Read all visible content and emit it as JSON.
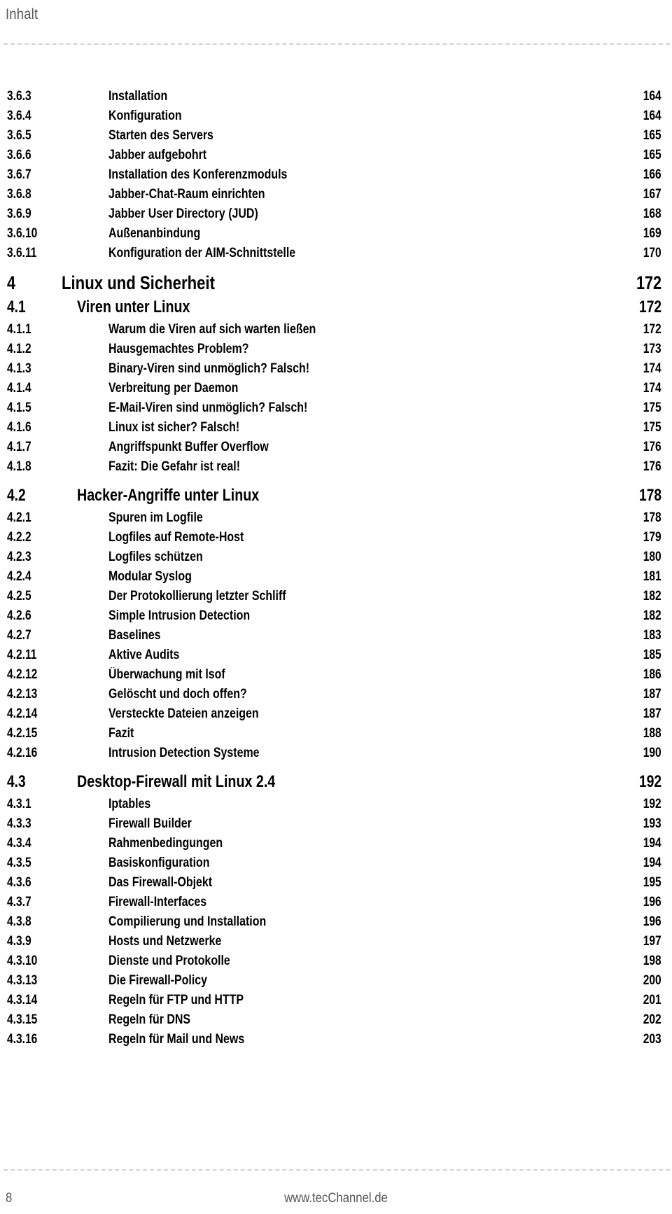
{
  "header": {
    "title": "Inhalt"
  },
  "footer": {
    "page_number": "8",
    "site": "www.tecChannel.de"
  },
  "colors": {
    "text": "#000000",
    "muted": "#55555a",
    "rule": "#d2d2d6",
    "background": "#ffffff"
  },
  "toc": {
    "entries": [
      {
        "level": "sub",
        "number": "3.6.3",
        "title": "Installation",
        "page": "164"
      },
      {
        "level": "sub",
        "number": "3.6.4",
        "title": "Konfiguration",
        "page": "164"
      },
      {
        "level": "sub",
        "number": "3.6.5",
        "title": "Starten des Servers",
        "page": "165"
      },
      {
        "level": "sub",
        "number": "3.6.6",
        "title": "Jabber aufgebohrt",
        "page": "165"
      },
      {
        "level": "sub",
        "number": "3.6.7",
        "title": "Installation des Konferenzmoduls",
        "page": "166"
      },
      {
        "level": "sub",
        "number": "3.6.8",
        "title": "Jabber-Chat-Raum einrichten",
        "page": "167"
      },
      {
        "level": "sub",
        "number": "3.6.9",
        "title": "Jabber User Directory (JUD)",
        "page": "168"
      },
      {
        "level": "sub",
        "number": "3.6.10",
        "title": "Außenanbindung",
        "page": "169"
      },
      {
        "level": "sub",
        "number": "3.6.11",
        "title": "Konfiguration der AIM-Schnittstelle",
        "page": "170"
      },
      {
        "level": "chap",
        "number": "4",
        "title": "Linux und Sicherheit",
        "page": "172"
      },
      {
        "level": "sec",
        "number": "4.1",
        "title": "Viren unter Linux",
        "page": "172"
      },
      {
        "level": "sub",
        "number": "4.1.1",
        "title": "Warum die Viren auf sich warten ließen",
        "page": "172"
      },
      {
        "level": "sub",
        "number": "4.1.2",
        "title": "Hausgemachtes Problem?",
        "page": "173"
      },
      {
        "level": "sub",
        "number": "4.1.3",
        "title": "Binary-Viren sind unmöglich? Falsch!",
        "page": "174"
      },
      {
        "level": "sub",
        "number": "4.1.4",
        "title": "Verbreitung per Daemon",
        "page": "174"
      },
      {
        "level": "sub",
        "number": "4.1.5",
        "title": "E-Mail-Viren sind unmöglich? Falsch!",
        "page": "175"
      },
      {
        "level": "sub",
        "number": "4.1.6",
        "title": "Linux ist sicher? Falsch!",
        "page": "175"
      },
      {
        "level": "sub",
        "number": "4.1.7",
        "title": "Angriffspunkt Buffer Overflow",
        "page": "176"
      },
      {
        "level": "sub",
        "number": "4.1.8",
        "title": "Fazit: Die Gefahr ist real!",
        "page": "176"
      },
      {
        "level": "sec",
        "number": "4.2",
        "title": "Hacker-Angriffe unter Linux",
        "page": "178"
      },
      {
        "level": "sub",
        "number": "4.2.1",
        "title": "Spuren im Logfile",
        "page": "178"
      },
      {
        "level": "sub",
        "number": "4.2.2",
        "title": "Logfiles auf Remote-Host",
        "page": "179"
      },
      {
        "level": "sub",
        "number": "4.2.3",
        "title": "Logfiles schützen",
        "page": "180"
      },
      {
        "level": "sub",
        "number": "4.2.4",
        "title": "Modular Syslog",
        "page": "181"
      },
      {
        "level": "sub",
        "number": "4.2.5",
        "title": "Der Protokollierung letzter Schliff",
        "page": "182"
      },
      {
        "level": "sub",
        "number": "4.2.6",
        "title": "Simple Intrusion Detection",
        "page": "182"
      },
      {
        "level": "sub",
        "number": "4.2.7",
        "title": "Baselines",
        "page": "183"
      },
      {
        "level": "sub",
        "number": "4.2.11",
        "title": "Aktive Audits",
        "page": "185"
      },
      {
        "level": "sub",
        "number": "4.2.12",
        "title": "Überwachung mit lsof",
        "page": "186"
      },
      {
        "level": "sub",
        "number": "4.2.13",
        "title": "Gelöscht und doch offen?",
        "page": "187"
      },
      {
        "level": "sub",
        "number": "4.2.14",
        "title": "Versteckte Dateien anzeigen",
        "page": "187"
      },
      {
        "level": "sub",
        "number": "4.2.15",
        "title": "Fazit",
        "page": "188"
      },
      {
        "level": "sub",
        "number": "4.2.16",
        "title": "Intrusion Detection Systeme",
        "page": "190"
      },
      {
        "level": "sec",
        "number": "4.3",
        "title": "Desktop-Firewall mit Linux 2.4",
        "page": "192"
      },
      {
        "level": "sub",
        "number": "4.3.1",
        "title": "Iptables",
        "page": "192"
      },
      {
        "level": "sub",
        "number": "4.3.3",
        "title": "Firewall Builder",
        "page": "193"
      },
      {
        "level": "sub",
        "number": "4.3.4",
        "title": "Rahmenbedingungen",
        "page": "194"
      },
      {
        "level": "sub",
        "number": "4.3.5",
        "title": "Basiskonfiguration",
        "page": "194"
      },
      {
        "level": "sub",
        "number": "4.3.6",
        "title": "Das Firewall-Objekt",
        "page": "195"
      },
      {
        "level": "sub",
        "number": "4.3.7",
        "title": "Firewall-Interfaces",
        "page": "196"
      },
      {
        "level": "sub",
        "number": "4.3.8",
        "title": "Compilierung und Installation",
        "page": "196"
      },
      {
        "level": "sub",
        "number": "4.3.9",
        "title": "Hosts und Netzwerke",
        "page": "197"
      },
      {
        "level": "sub",
        "number": "4.3.10",
        "title": "Dienste und Protokolle",
        "page": "198"
      },
      {
        "level": "sub",
        "number": "4.3.13",
        "title": "Die Firewall-Policy",
        "page": "200"
      },
      {
        "level": "sub",
        "number": "4.3.14",
        "title": "Regeln für FTP und HTTP",
        "page": "201"
      },
      {
        "level": "sub",
        "number": "4.3.15",
        "title": "Regeln für DNS",
        "page": "202"
      },
      {
        "level": "sub",
        "number": "4.3.16",
        "title": "Regeln für Mail und News",
        "page": "203"
      }
    ]
  }
}
